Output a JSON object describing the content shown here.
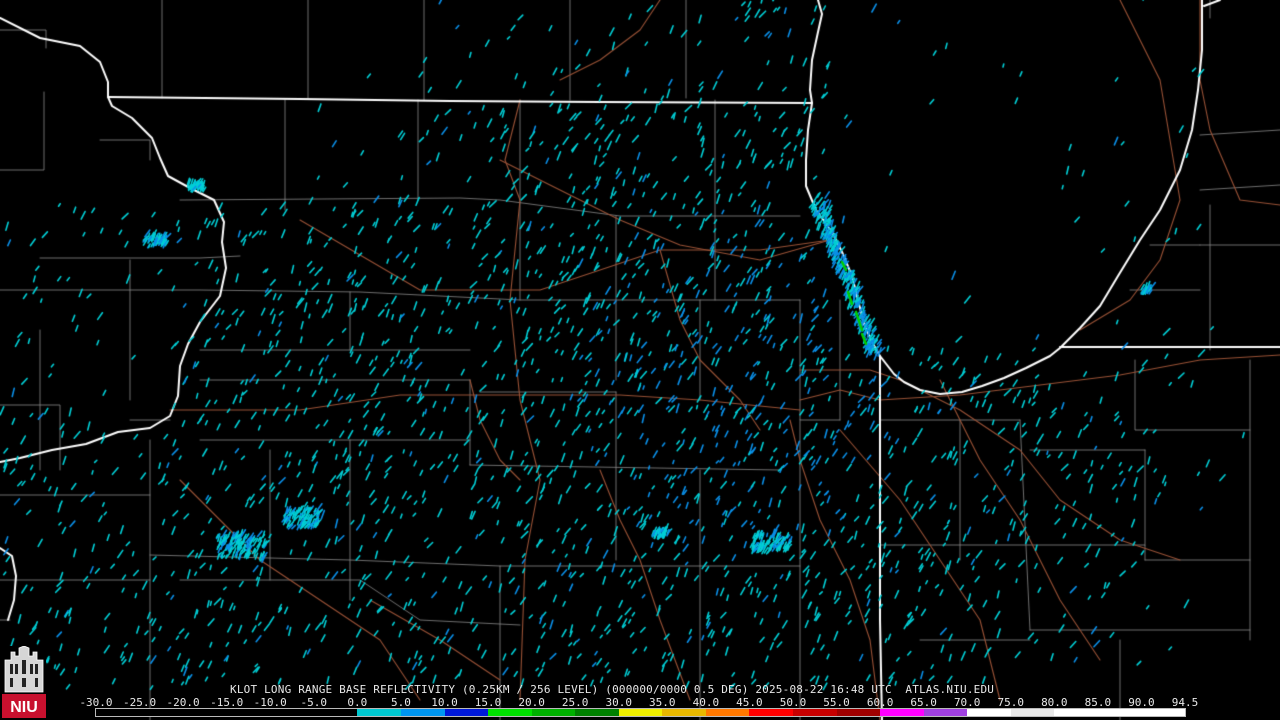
{
  "product_title": "KLOT LONG RANGE BASE REFLECTIVITY (0.25KM / 256 LEVEL) (000000/0000 0.5 DEG) 2025-08-22 16:48 UTC  ATLAS.NIU.EDU",
  "color_scale": {
    "labels": [
      "-30.0",
      "-25.0",
      "-20.0",
      "-15.0",
      "-10.0",
      "-5.0",
      "0.0",
      "5.0",
      "10.0",
      "15.0",
      "20.0",
      "25.0",
      "30.0",
      "35.0",
      "40.0",
      "45.0",
      "50.0",
      "55.0",
      "60.0",
      "65.0",
      "70.0",
      "75.0",
      "80.0",
      "85.0",
      "90.0",
      "94.5"
    ],
    "colors": [
      "#000000",
      "#000000",
      "#000000",
      "#000000",
      "#000000",
      "#000000",
      "#00c8d0",
      "#0096f0",
      "#0018d8",
      "#00e000",
      "#00b000",
      "#008000",
      "#f0f000",
      "#e8b800",
      "#ff7800",
      "#ff0000",
      "#c80000",
      "#a00000",
      "#ff00ff",
      "#a040e0",
      "#ffffff",
      "#e8e8e8",
      "#ffffff",
      "#ffffff",
      "#ffffff"
    ]
  },
  "colors": {
    "background": "#000000",
    "state_border": "#ffffff",
    "county_border": "#8c8c8c",
    "road": "#9a5236",
    "echo_light": "#00cfd6",
    "echo_mid": "#0a8fe8",
    "echo_strong": "#00d000"
  },
  "logo": {
    "text": "NIU",
    "icon": "niu-logo-icon"
  }
}
